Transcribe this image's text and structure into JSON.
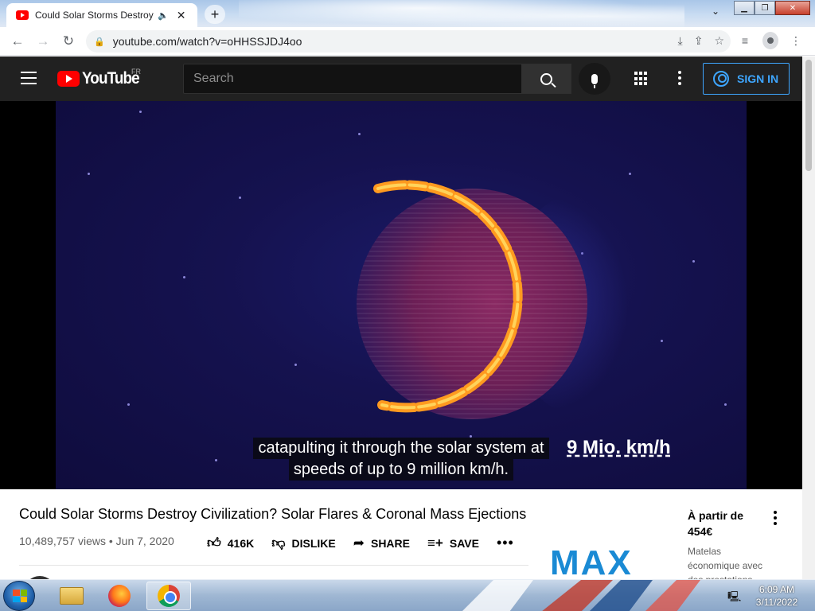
{
  "browser": {
    "tab_title": "Could Solar Storms Destroy Civilization? Solar Flares & Coronal Mass Ejections",
    "url": "youtube.com/watch?v=oHHSSJDJ4oo"
  },
  "youtube": {
    "logo_text": "YouTube",
    "region": "FR",
    "search_placeholder": "Search",
    "sign_in": "SIGN IN"
  },
  "player": {
    "caption_line1": "catapulting it through the solar system at",
    "caption_line2": "speeds of up to 9 million km/h.",
    "overlay_text": "9 Mio. km/h"
  },
  "video": {
    "title": "Could Solar Storms Destroy Civilization? Solar Flares & Coronal Mass Ejections",
    "views": "10,489,757 views",
    "date": "Jun 7, 2020",
    "likes": "416K",
    "dislike": "DISLIKE",
    "share": "SHARE",
    "save": "SAVE"
  },
  "ad": {
    "brand": "MAX",
    "price_prefix": "À partir de",
    "price": "454€",
    "description": "Matelas économique avec des prestations"
  },
  "taskbar": {
    "time": "6:09 AM",
    "date": "3/11/2022"
  },
  "colors": {
    "youtube_red": "#ff0000",
    "signin_blue": "#3ea6ff",
    "header_bg": "#212121",
    "flare_orange": "#ff9a1f"
  }
}
